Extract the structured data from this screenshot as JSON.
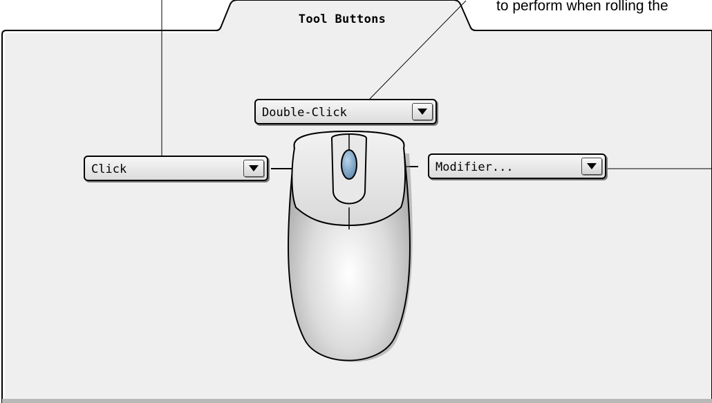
{
  "panel": {
    "tab_title": "Tool Buttons"
  },
  "callout": {
    "text": "to perform when rolling the"
  },
  "popups": {
    "upper_button": {
      "value": "Double-Click"
    },
    "lower_button": {
      "value": "Click"
    },
    "side_button": {
      "value": "Modifier..."
    }
  },
  "icons": {
    "mouse": "mouse-icon",
    "dropdown": "triangle-down-icon"
  },
  "colors": {
    "panel_background": "#efefef",
    "scroll_wheel": "#7ea6c8",
    "border": "#000000"
  }
}
